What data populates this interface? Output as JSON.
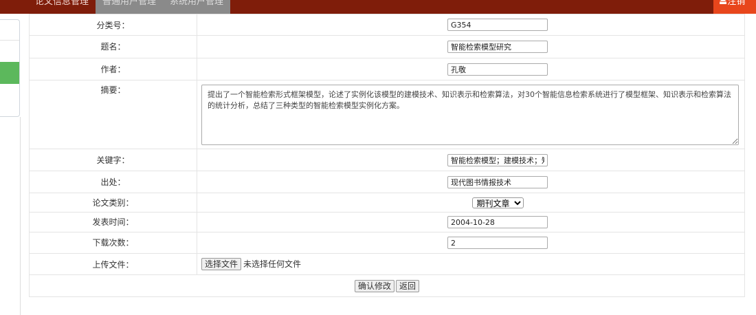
{
  "nav": {
    "items": [
      "论文信息管理",
      "普通用户管理",
      "系统用户管理"
    ],
    "logout": "注销"
  },
  "form": {
    "classno": {
      "label": "分类号：",
      "value": "G354"
    },
    "title": {
      "label": "题名：",
      "value": "智能检索模型研究"
    },
    "author": {
      "label": "作者：",
      "value": "孔敬"
    },
    "abstract": {
      "label": "摘要：",
      "value": "提出了一个智能检索形式框架模型，论述了实例化该模型的建模技术、知识表示和检索算法，对30个智能信息检索系统进行了模型框架、知识表示和检索算法的统计分析，总结了三种类型的智能检索模型实例化方案。"
    },
    "keywords": {
      "label": "关键字：",
      "value": "智能检索模型；建模技术；知识表示；检索算法"
    },
    "source": {
      "label": "出处：",
      "value": "现代图书情报技术"
    },
    "category": {
      "label": "论文类别：",
      "value": "期刊文章"
    },
    "pubdate": {
      "label": "发表时间：",
      "value": "2004-10-28"
    },
    "downloads": {
      "label": "下载次数：",
      "value": "2"
    },
    "upload": {
      "label": "上传文件：",
      "button": "选择文件",
      "status": "未选择任何文件"
    }
  },
  "actions": {
    "confirm": "确认修改",
    "back": "返回"
  }
}
